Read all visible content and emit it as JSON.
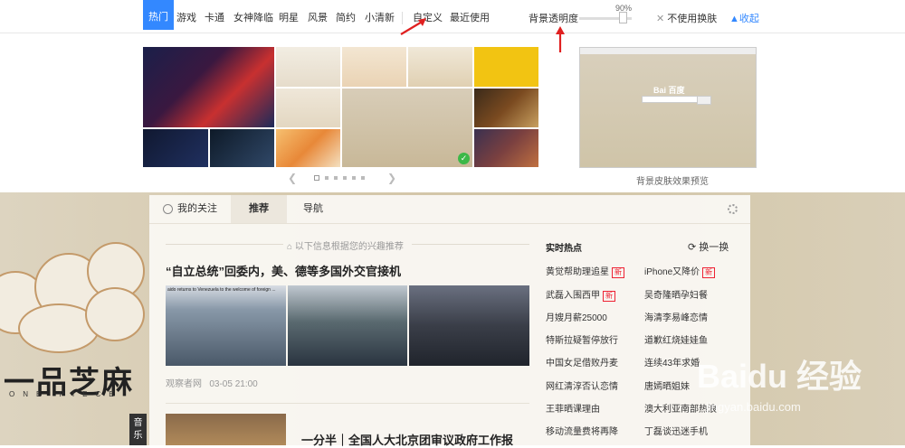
{
  "skin_tabs": [
    "热门",
    "游戏",
    "卡通",
    "女神降临",
    "明星",
    "风景",
    "简约",
    "小清新",
    "自定义",
    "最近使用"
  ],
  "opacity": {
    "label": "背景透明度",
    "value": "90%",
    "level": 0.9
  },
  "no_skin": "不使用换肤",
  "collapse": "收起",
  "preview": {
    "label": "背景皮肤效果预览",
    "logo": "Bai 百度"
  },
  "pager": {
    "count": 6,
    "active": 0
  },
  "colors": {
    "accent": "#3388ff",
    "badge_red": "#ee2233",
    "check_green": "#3cb848",
    "annotation_red": "#e02020"
  },
  "content_tabs": [
    {
      "label": "我的关注",
      "icon": "person-icon"
    },
    {
      "label": "推荐"
    },
    {
      "label": "导航"
    }
  ],
  "feed_hint": "以下信息根据您的兴趣推荐",
  "article1": {
    "title": "“自立总统”回委内，美、德等多国外交官接机",
    "caption": "aido returns to Venezuela to the welcome of foreign ...",
    "source": "观察者网",
    "time": "03-05 21:00"
  },
  "article2": {
    "title": "一分半｜全国人大北京团审议政府工作报"
  },
  "hot": {
    "title": "实时热点",
    "refresh": "换一换",
    "left": [
      {
        "text": "黄觉帮助理追星",
        "badge": "新"
      },
      {
        "text": "武磊入围西甲",
        "badge": "新"
      },
      {
        "text": "月嫂月薪25000"
      },
      {
        "text": "特斯拉疑暂停放行"
      },
      {
        "text": "中国女足借败丹麦"
      },
      {
        "text": "网红清淳否认恋情"
      },
      {
        "text": "王菲晒课理由"
      },
      {
        "text": "移动流量费将再降"
      }
    ],
    "right": [
      {
        "text": "iPhone又降价",
        "badge": "新"
      },
      {
        "text": "吴奇隆晒孕妇餐"
      },
      {
        "text": "海清李易峰恋情"
      },
      {
        "text": "道歉红烧娃娃鱼"
      },
      {
        "text": "连续43年求婚"
      },
      {
        "text": "唐嫣晒姐妹"
      },
      {
        "text": "澳大利亚南部热浪"
      },
      {
        "text": "丁磊谈迅迷手机"
      }
    ]
  },
  "music": "音乐",
  "seal": {
    "main": "一品芝麻",
    "sub": "ONE PIECE"
  },
  "watermark": {
    "main": "Baidu 经验",
    "sub": "jingyan.baidu.com"
  }
}
